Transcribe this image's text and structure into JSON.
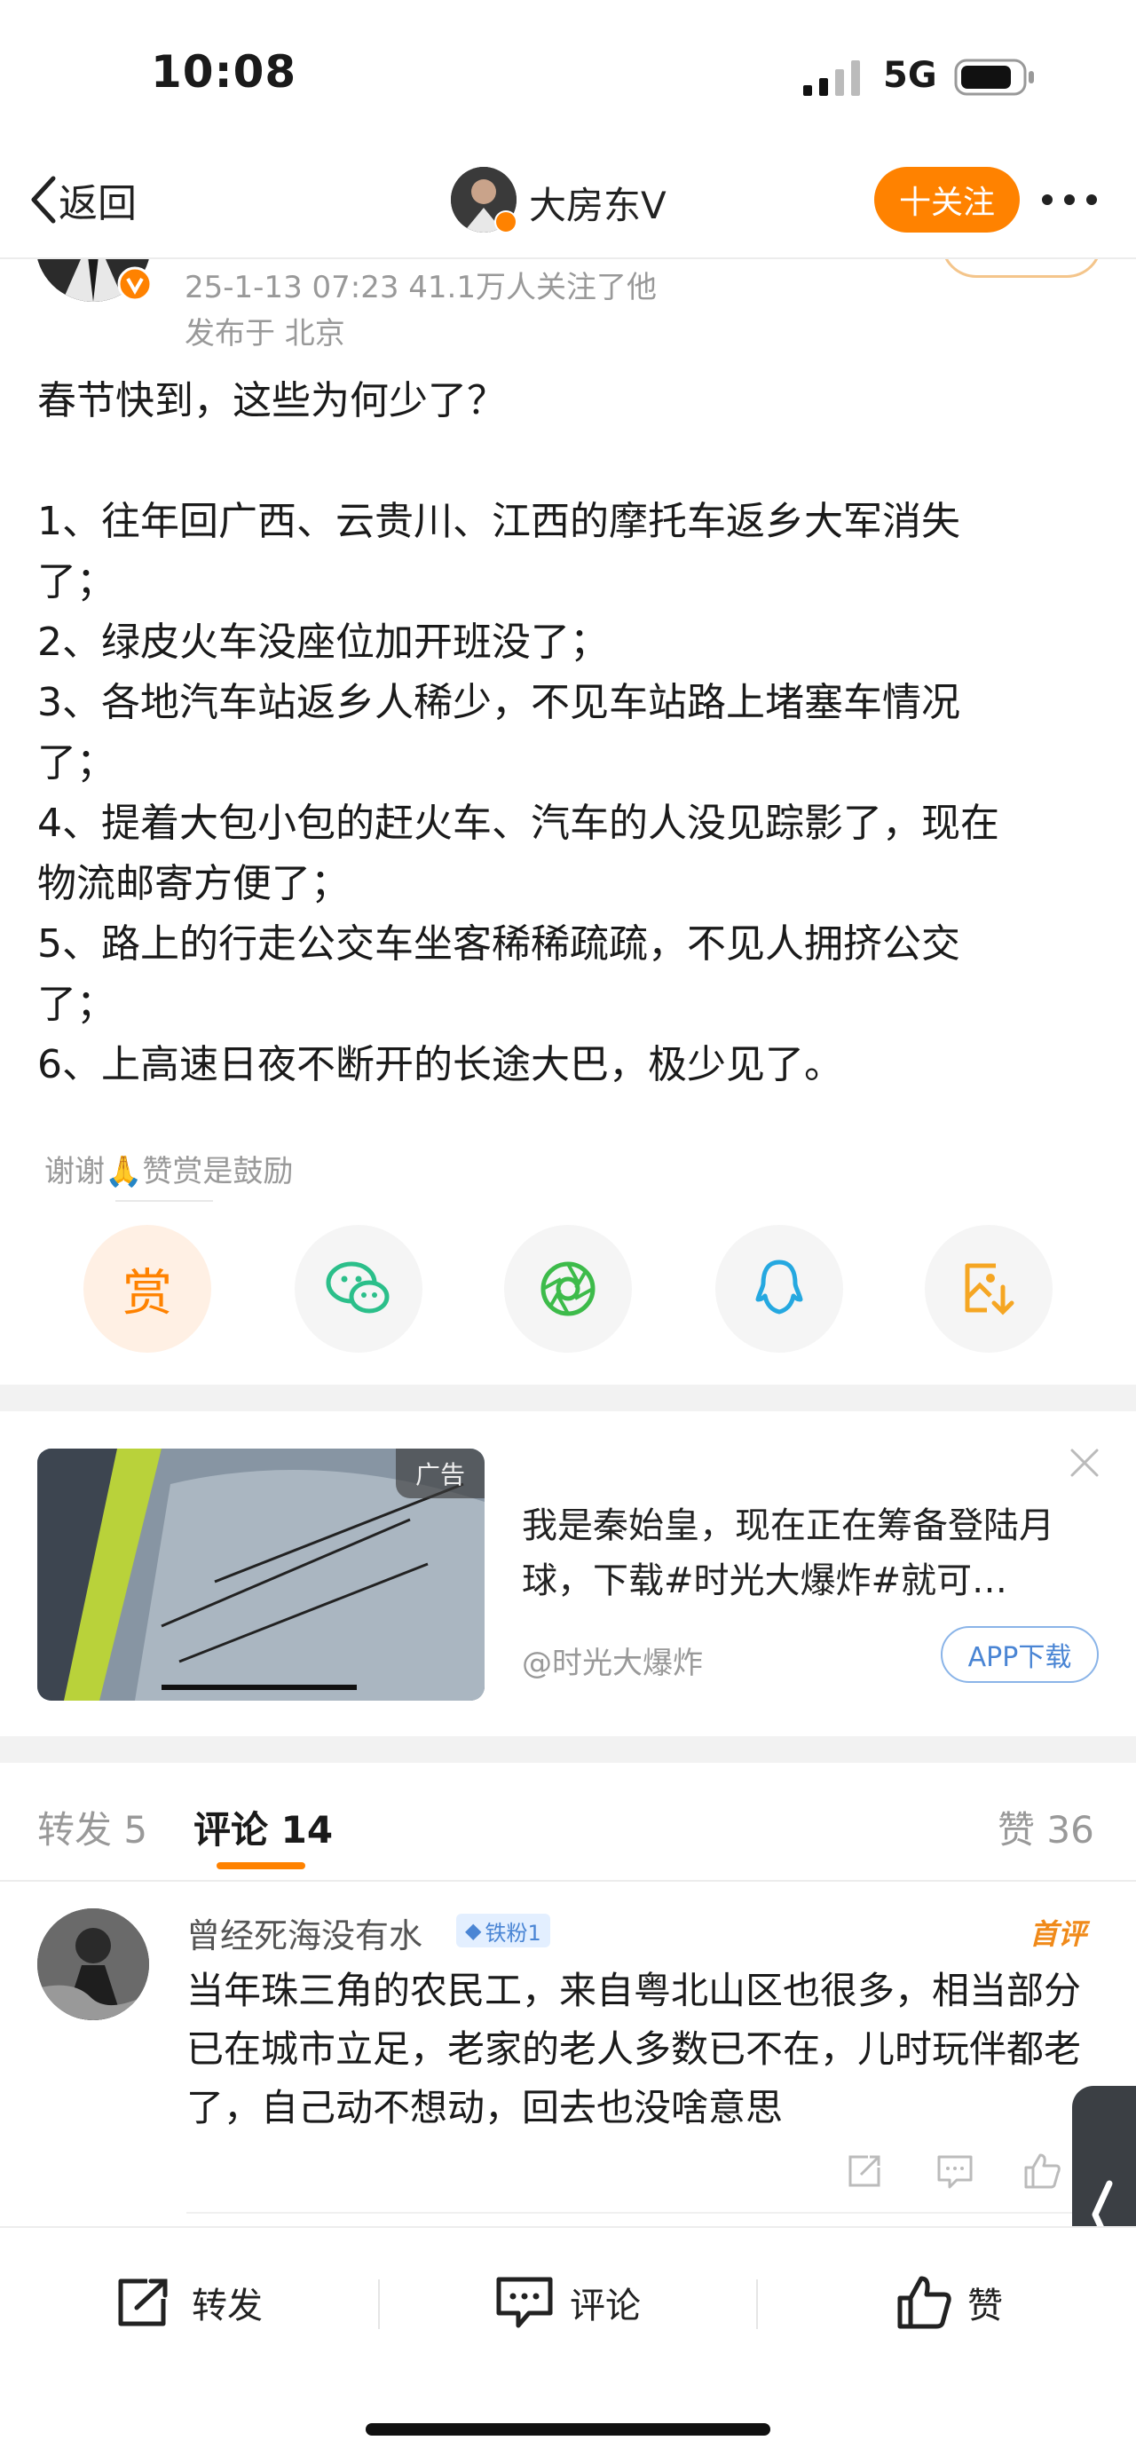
{
  "status_bar": {
    "time": "10:08",
    "network": "5G"
  },
  "nav": {
    "back_label": "返回",
    "title": "大房东Ⅴ",
    "follow_label": "十关注"
  },
  "post": {
    "meta_line1": "25-1-13 07:23  41.1万人关注了他",
    "meta_line2": "发布于 北京",
    "lines": [
      "春节快到，这些为何少了？",
      "",
      "1、往年回广西、云贵川、江西的摩托车返乡大军消失",
      "了；",
      "2、绿皮火车没座位加开班没了；",
      "3、各地汽车站返乡人稀少，不见车站路上堵塞车情况",
      "了；",
      "4、提着大包小包的赶火车、汽车的人没见踪影了，现在",
      "物流邮寄方便了；",
      "5、路上的行走公交车坐客稀稀疏疏，不见人拥挤公交",
      "了；",
      "6、上高速日夜不断开的长途大巴，极少见了。"
    ],
    "thanks": "谢谢🙏赞赏是鼓励",
    "reward_label": "赏",
    "share_icons": [
      "wechat-icon",
      "moments-icon",
      "qq-icon",
      "save-image-icon"
    ]
  },
  "ad": {
    "tag": "广告",
    "text": "我是秦始皇，现在正在筹备登陆月球，下载#时光大爆炸#就可…",
    "source": "@时光大爆炸",
    "button": "APP下载"
  },
  "tabs": {
    "repost": "转发 5",
    "comments": "评论 14",
    "likes": "赞 36"
  },
  "comment": {
    "author": "曾经死海没有水",
    "badge": "铁粉1",
    "first_label": "首评",
    "text": "当年珠三角的农民工，来自粤北山区也很多，相当部分已在城市立足，老家的老人多数已不在，儿时玩伴都老了，自己动不想动，回去也没啥意思"
  },
  "bottom_bar": {
    "repost": "转发",
    "comment": "评论",
    "like": "赞"
  },
  "colors": {
    "accent": "#ff8200",
    "link": "#4a85d4"
  }
}
